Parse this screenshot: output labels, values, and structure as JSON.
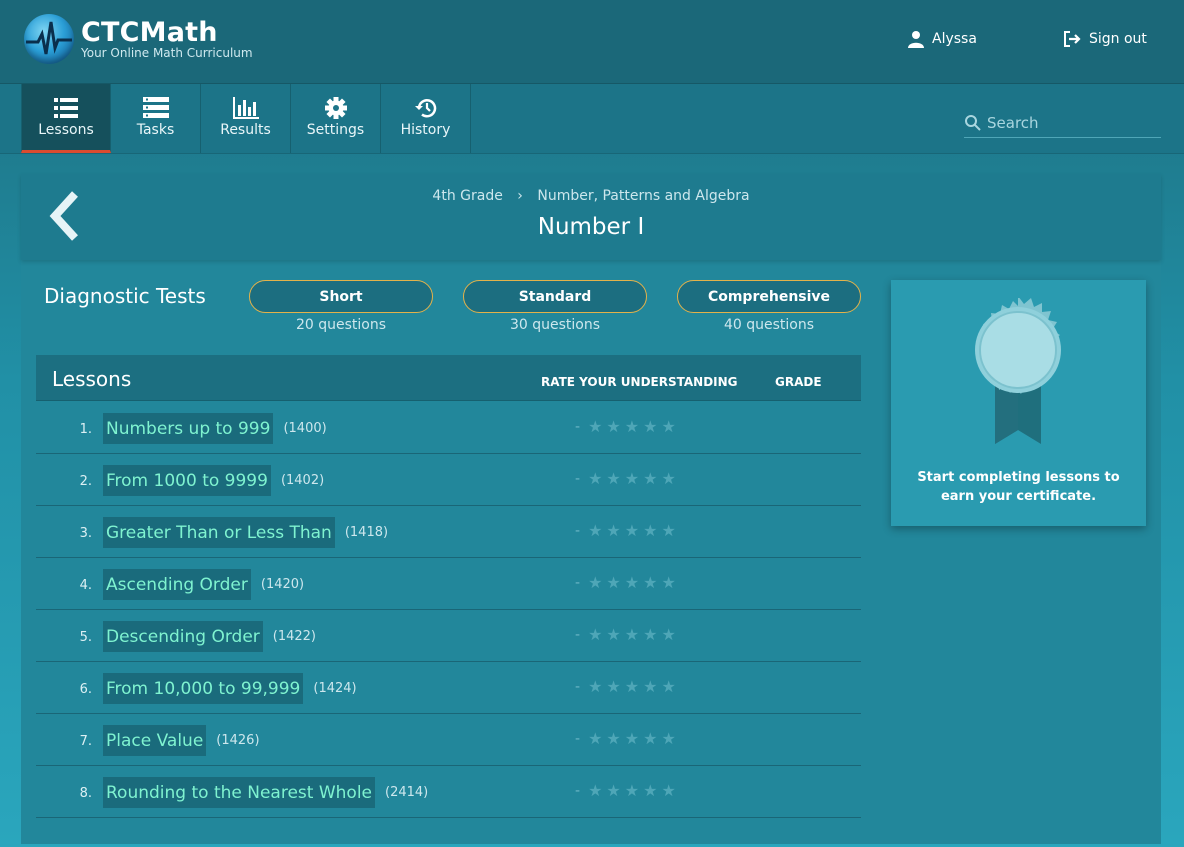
{
  "app": {
    "title": "CTCMath",
    "subtitle": "Your Online Math Curriculum"
  },
  "header": {
    "user_name": "Alyssa",
    "signout_label": "Sign out"
  },
  "nav": {
    "items": [
      {
        "label": "Lessons",
        "icon": "list-icon",
        "active": true
      },
      {
        "label": "Tasks",
        "icon": "tasks-icon",
        "active": false
      },
      {
        "label": "Results",
        "icon": "bar-chart-icon",
        "active": false
      },
      {
        "label": "Settings",
        "icon": "gear-icon",
        "active": false
      },
      {
        "label": "History",
        "icon": "history-icon",
        "active": false
      }
    ]
  },
  "search": {
    "placeholder": "Search",
    "value": ""
  },
  "breadcrumb": {
    "grade": "4th Grade",
    "separator": "›",
    "strand": "Number, Patterns and Algebra"
  },
  "page": {
    "title": "Number I"
  },
  "diagnostic": {
    "title": "Diagnostic Tests",
    "tests": [
      {
        "label": "Short",
        "questions": "20 questions"
      },
      {
        "label": "Standard",
        "questions": "30 questions"
      },
      {
        "label": "Comprehensive",
        "questions": "40 questions"
      }
    ]
  },
  "lessons": {
    "title": "Lessons",
    "col_rate": "RATE YOUR UNDERSTANDING",
    "col_grade": "GRADE",
    "rating_placeholder": "-",
    "items": [
      {
        "num": "1.",
        "name": "Numbers up to 999",
        "code": "(1400)"
      },
      {
        "num": "2.",
        "name": "From 1000 to 9999",
        "code": "(1402)"
      },
      {
        "num": "3.",
        "name": "Greater Than or Less Than",
        "code": "(1418)"
      },
      {
        "num": "4.",
        "name": "Ascending Order",
        "code": "(1420)"
      },
      {
        "num": "5.",
        "name": "Descending Order",
        "code": "(1422)"
      },
      {
        "num": "6.",
        "name": "From 10,000 to 99,999",
        "code": "(1424)"
      },
      {
        "num": "7.",
        "name": "Place Value",
        "code": "(1426)"
      },
      {
        "num": "8.",
        "name": "Rounding to the Nearest Whole",
        "code": "(2414)"
      }
    ]
  },
  "certificate": {
    "message": "Start completing lessons to earn your certificate."
  },
  "colors": {
    "accent_link": "#7ff3d0",
    "active_tab_underline": "#d94b2f",
    "button_border": "#e3b24a"
  }
}
